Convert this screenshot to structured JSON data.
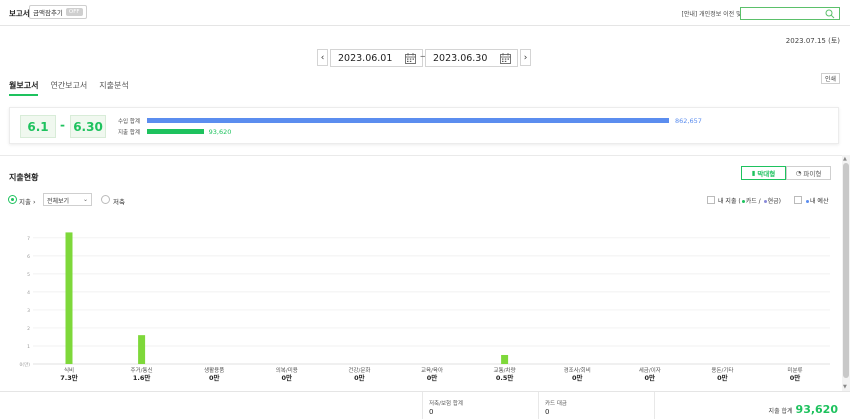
{
  "topbar": {
    "brand": "보고서",
    "pill_label": "금액잠추기",
    "pill_badge": "OFF",
    "notice": "[안내] 개인정보 이전 및 이용약.",
    "search_placeholder": ""
  },
  "date_range": {
    "today": "2023.07.15 (토)",
    "start": "2023.06.01",
    "end": "2023.06.30",
    "separator": "—",
    "print": "인쇄"
  },
  "tabs": [
    {
      "label": "월보고서",
      "active": true
    },
    {
      "label": "연간보고서",
      "active": false
    },
    {
      "label": "지출분석",
      "active": false
    }
  ],
  "summary": {
    "start_label": "6.1",
    "end_label": "6.30",
    "dash": "-",
    "income_label": "수입 합계",
    "income_value": "862,657",
    "income_amount": 862657,
    "expense_label": "지출 합계",
    "expense_value": "93,620",
    "expense_amount": 93620,
    "income_color": "#5b8def",
    "expense_color": "#1ec25e"
  },
  "expense": {
    "title": "지출현황",
    "view_bar": "막대형",
    "view_pie": "파이형",
    "radio_expense": "지출",
    "radio_save": "저축",
    "select_value": "전체보기",
    "chk_mine_pre": "내 지출 (",
    "chk_card": "카드",
    "chk_sep": " / ",
    "chk_cash": "현금",
    "chk_mine_post": ")",
    "chk_budget": "내 예산",
    "card_color": "#1ec25e",
    "cash_color": "#8a8ad8",
    "budget_color": "#5b8def"
  },
  "chart_data": {
    "type": "bar",
    "ylabels": [
      "7",
      "6",
      "5",
      "4",
      "3",
      "2",
      "1",
      "0(만)"
    ],
    "ylim": [
      0,
      7.6
    ],
    "categories": [
      "식비",
      "주거/통신",
      "생활용품",
      "의복/미용",
      "건강/문화",
      "교육/육아",
      "교통/차량",
      "경조사/회비",
      "세금/이자",
      "용돈/기타",
      "미분류"
    ],
    "values": [
      7.3,
      1.6,
      0,
      0,
      0,
      0,
      0.5,
      0,
      0,
      0,
      0
    ],
    "value_labels": [
      "7.3만",
      "1.6만",
      "0만",
      "0만",
      "0만",
      "0만",
      "0.5만",
      "0만",
      "0만",
      "0만",
      "0만"
    ],
    "bar_color": "#7ed83a"
  },
  "footer": {
    "save_total_label": "저축/보험 합계",
    "save_total_value": "0",
    "card_debt_label": "카드 대금",
    "card_debt_value": "0",
    "total_label": "지출 합계",
    "total_value": "93,620"
  }
}
